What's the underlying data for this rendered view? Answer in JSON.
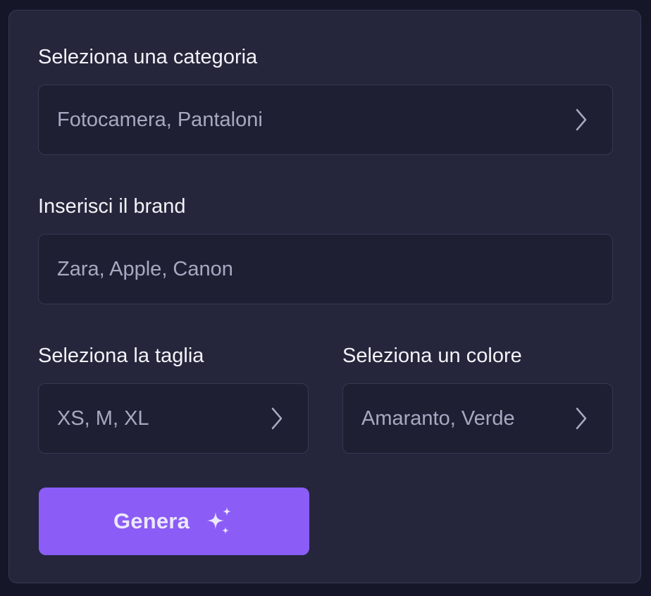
{
  "form": {
    "category": {
      "label": "Seleziona una categoria",
      "placeholder": "Fotocamera, Pantaloni",
      "icon": "chevron-right-icon"
    },
    "brand": {
      "label": "Inserisci il brand",
      "placeholder": "Zara, Apple, Canon"
    },
    "size": {
      "label": "Seleziona la taglia",
      "placeholder": "XS, M, XL",
      "icon": "chevron-right-icon"
    },
    "color": {
      "label": "Seleziona un colore",
      "placeholder": "Amaranto, Verde",
      "icon": "chevron-right-icon"
    },
    "generate_button": {
      "label": "Genera",
      "icon": "sparkles-icon"
    }
  },
  "colors": {
    "accent": "#8b5cf6",
    "card_background": "#25263b",
    "field_background": "#1e1f33"
  }
}
